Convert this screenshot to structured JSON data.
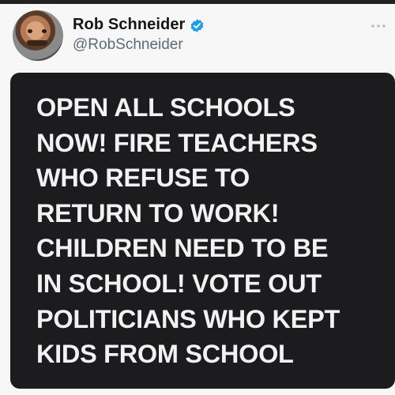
{
  "tweet": {
    "author": {
      "display_name": "Rob Schneider",
      "handle": "@RobSchneider",
      "verified": true
    },
    "image_text_lines": [
      "OPEN ALL SCHOOLS",
      "NOW! FIRE TEACHERS",
      "WHO REFUSE TO",
      "RETURN TO WORK!",
      "CHILDREN NEED TO BE",
      "IN SCHOOL! VOTE OUT",
      "POLITICIANS WHO KEPT",
      "KIDS FROM SCHOOL"
    ]
  },
  "icons": {
    "verified": "verified-badge-icon",
    "more": "more-options-icon"
  },
  "colors": {
    "verified_blue": "#1d9bf0",
    "card_background": "#1c1c1e",
    "card_text": "#f2f2f2",
    "name_text": "#141414",
    "handle_text": "#5f6b75"
  }
}
